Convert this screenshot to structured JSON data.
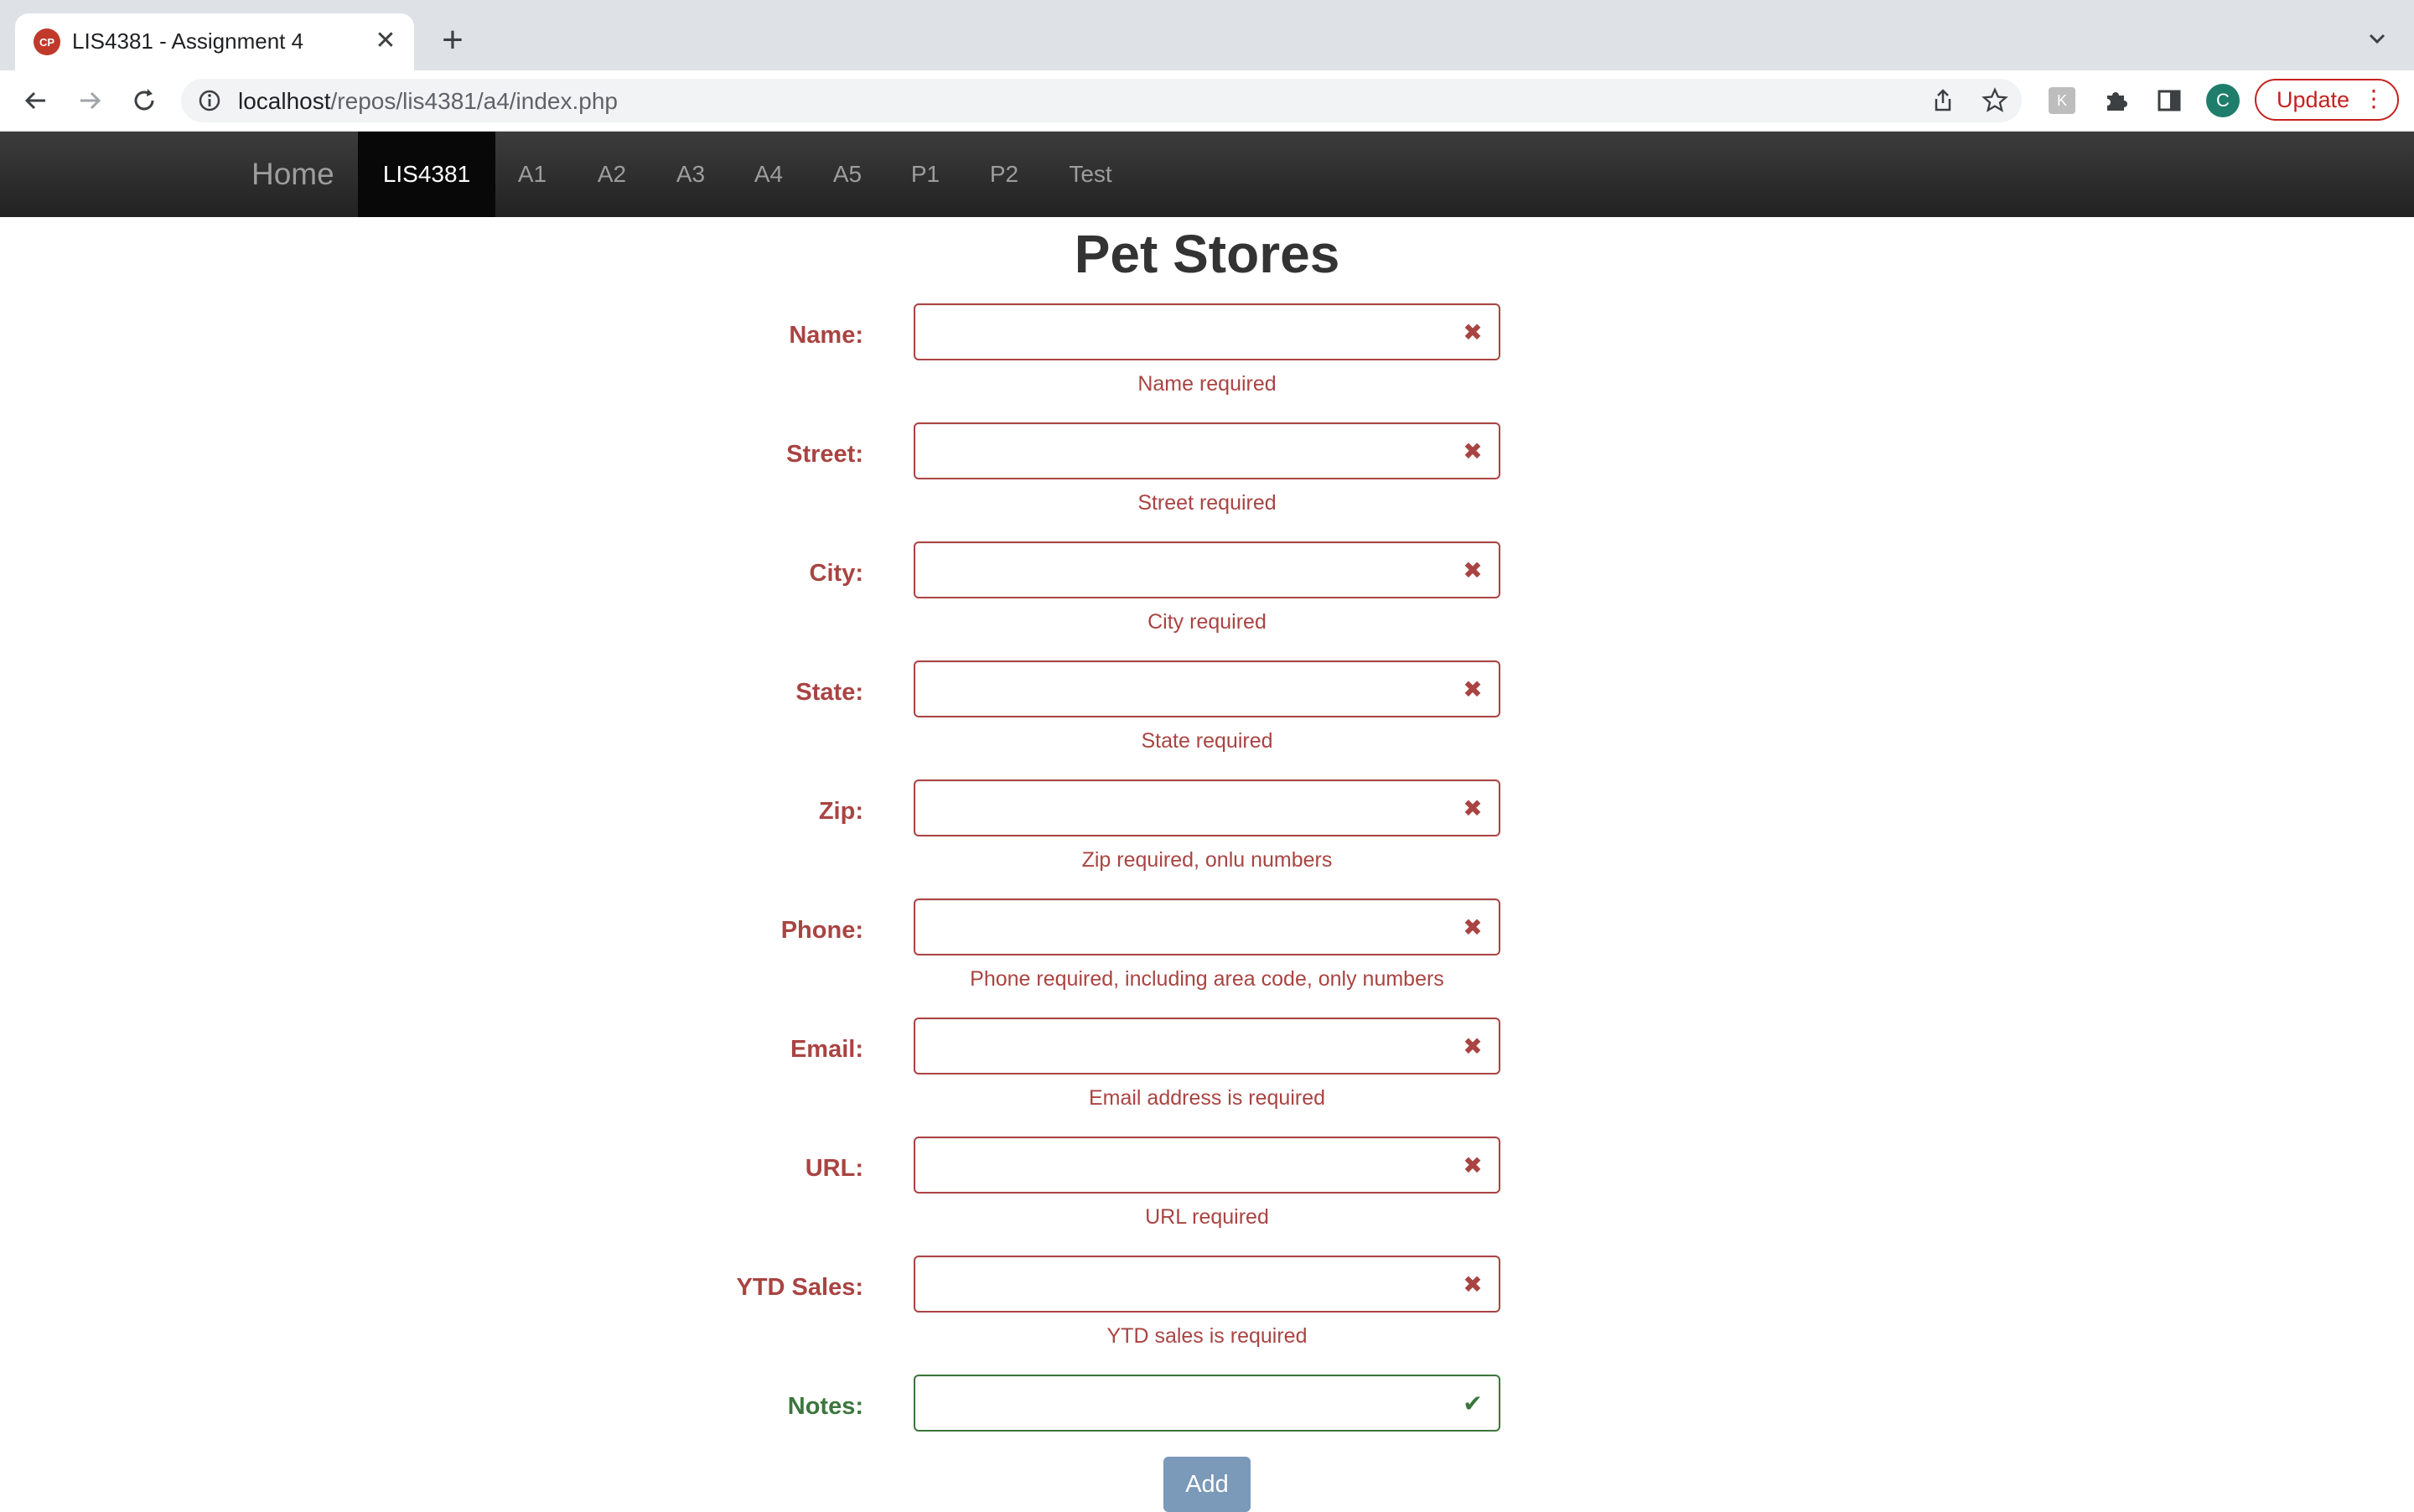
{
  "browser": {
    "tab_title": "LIS4381 - Assignment 4",
    "tab_favicon_text": "CP",
    "tab_close": "✕",
    "new_tab": "+",
    "url_host": "localhost",
    "url_path": "/repos/lis4381/a4/index.php",
    "profile_initial": "C",
    "update_label": "Update",
    "update_menu": "⋮",
    "extension_label": "K"
  },
  "navbar": {
    "brand": "Home",
    "items": [
      {
        "label": "LIS4381",
        "active": true
      },
      {
        "label": "A1"
      },
      {
        "label": "A2"
      },
      {
        "label": "A3"
      },
      {
        "label": "A4"
      },
      {
        "label": "A5"
      },
      {
        "label": "P1"
      },
      {
        "label": "P2"
      },
      {
        "label": "Test"
      }
    ]
  },
  "page": {
    "title": "Pet Stores",
    "add_button": "Add"
  },
  "form": {
    "fields": [
      {
        "label": "Name:",
        "help": "Name required",
        "status": "error",
        "icon": "✖"
      },
      {
        "label": "Street:",
        "help": "Street required",
        "status": "error",
        "icon": "✖"
      },
      {
        "label": "City:",
        "help": "City required",
        "status": "error",
        "icon": "✖"
      },
      {
        "label": "State:",
        "help": "State required",
        "status": "error",
        "icon": "✖"
      },
      {
        "label": "Zip:",
        "help": "Zip required, onlu numbers",
        "status": "error",
        "icon": "✖"
      },
      {
        "label": "Phone:",
        "help": "Phone required, including area code, only numbers",
        "status": "error",
        "icon": "✖"
      },
      {
        "label": "Email:",
        "help": "Email address is required",
        "status": "error",
        "icon": "✖"
      },
      {
        "label": "URL:",
        "help": "URL required",
        "status": "error",
        "icon": "✖"
      },
      {
        "label": "YTD Sales:",
        "help": "YTD sales is required",
        "status": "error",
        "icon": "✖"
      },
      {
        "label": "Notes:",
        "help": "",
        "status": "success",
        "icon": "✔"
      }
    ]
  },
  "colors": {
    "error": "#a94442",
    "success": "#3c763d",
    "navbar_bg": "#222222",
    "button_bg": "#7b99b8"
  }
}
